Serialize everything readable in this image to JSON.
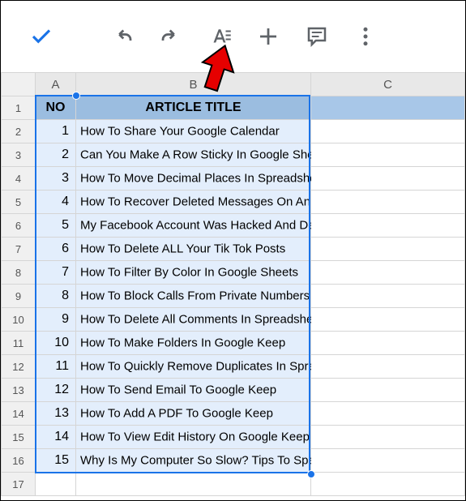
{
  "toolbar": {
    "confirm_icon": "check",
    "undo_icon": "undo",
    "redo_icon": "redo",
    "format_icon": "text-format",
    "add_icon": "plus",
    "comment_icon": "comment",
    "more_icon": "more-vert"
  },
  "columns": {
    "A": "A",
    "B": "B",
    "C": "C"
  },
  "header": {
    "no": "NO",
    "title": "ARTICLE TITLE"
  },
  "rows": [
    {
      "n": "1",
      "no": "1",
      "title": "How To Share Your Google Calendar"
    },
    {
      "n": "2",
      "no": "2",
      "title": "Can You Make A Row Sticky In Google Sheets?"
    },
    {
      "n": "3",
      "no": "3",
      "title": "How To Move Decimal Places In Spreadsheet"
    },
    {
      "n": "4",
      "no": "4",
      "title": "How To Recover Deleted Messages On An Android Device"
    },
    {
      "n": "5",
      "no": "5",
      "title": "My Facebook Account Was Hacked And Deleted – What"
    },
    {
      "n": "6",
      "no": "6",
      "title": "How To Delete ALL Your Tik Tok Posts"
    },
    {
      "n": "7",
      "no": "7",
      "title": "How To Filter By Color In Google Sheets"
    },
    {
      "n": "8",
      "no": "8",
      "title": "How To Block Calls From Private Numbers On Android"
    },
    {
      "n": "9",
      "no": "9",
      "title": "How To Delete All Comments In Spreadsheet"
    },
    {
      "n": "10",
      "no": "10",
      "title": "How To Make Folders In Google Keep"
    },
    {
      "n": "11",
      "no": "11",
      "title": "How To Quickly Remove Duplicates In Spreadsheet"
    },
    {
      "n": "12",
      "no": "12",
      "title": "How To Send Email To Google Keep"
    },
    {
      "n": "13",
      "no": "13",
      "title": "How To Add A PDF To Google Keep"
    },
    {
      "n": "14",
      "no": "14",
      "title": "How To View Edit History On Google Keep"
    },
    {
      "n": "15",
      "no": "15",
      "title": "Why Is My Computer So Slow? Tips To Speed Up Windows"
    }
  ],
  "row_headers": [
    "1",
    "2",
    "3",
    "4",
    "5",
    "6",
    "7",
    "8",
    "9",
    "10",
    "11",
    "12",
    "13",
    "14",
    "15",
    "16",
    "17"
  ]
}
